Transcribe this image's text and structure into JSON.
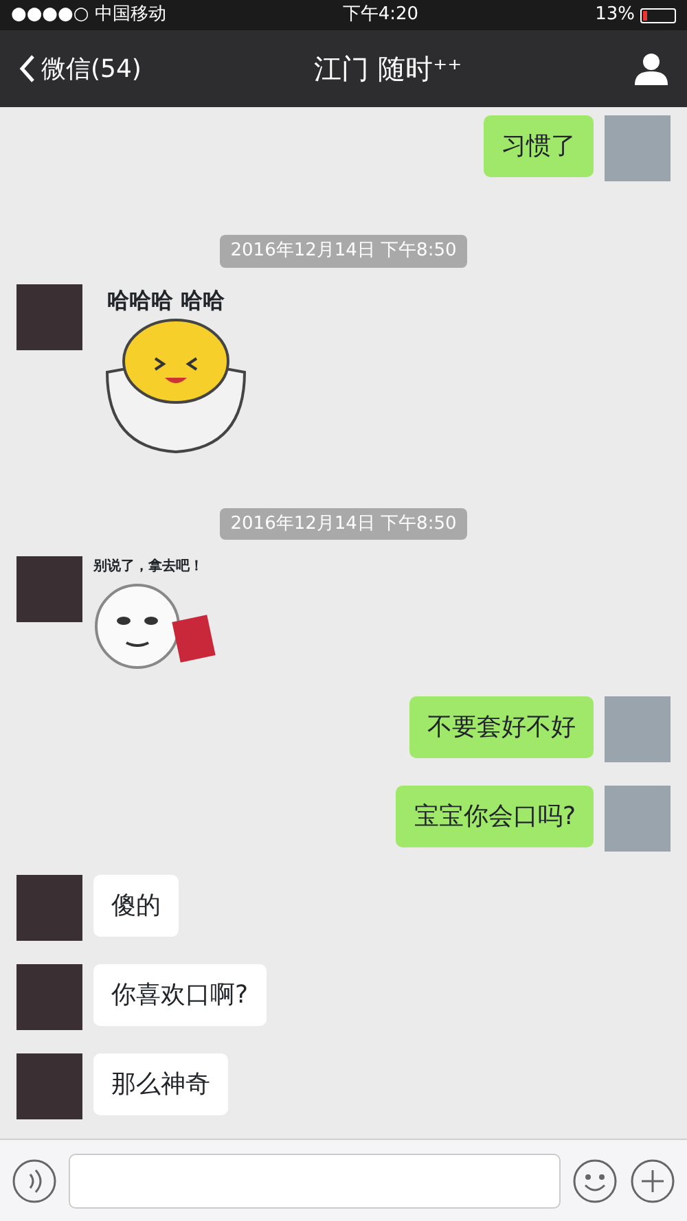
{
  "status_bar": {
    "carrier": "●●●●○ 中国移动",
    "time": "下午4:20",
    "battery": "13%"
  },
  "nav": {
    "back": "微信(54)",
    "title": "江门 随时⁺⁺"
  },
  "messages": [
    {
      "kind": "text",
      "outgoing": true,
      "text": "习惯了"
    },
    {
      "kind": "time",
      "text": "2016年12月14日 下午8:50"
    },
    {
      "kind": "eggsticker",
      "outgoing": false,
      "caption": "哈哈哈 哈哈"
    },
    {
      "kind": "time",
      "text": "2016年12月14日 下午8:50"
    },
    {
      "kind": "facesticker",
      "outgoing": false,
      "caption": "别说了，拿去吧！"
    },
    {
      "kind": "text",
      "outgoing": true,
      "text": "不要套好不好"
    },
    {
      "kind": "text",
      "outgoing": true,
      "text": "宝宝你会口吗?"
    },
    {
      "kind": "text",
      "outgoing": false,
      "text": "傻的"
    },
    {
      "kind": "text",
      "outgoing": false,
      "text": "你喜欢口啊?"
    },
    {
      "kind": "text",
      "outgoing": false,
      "text": "那么神奇"
    }
  ]
}
